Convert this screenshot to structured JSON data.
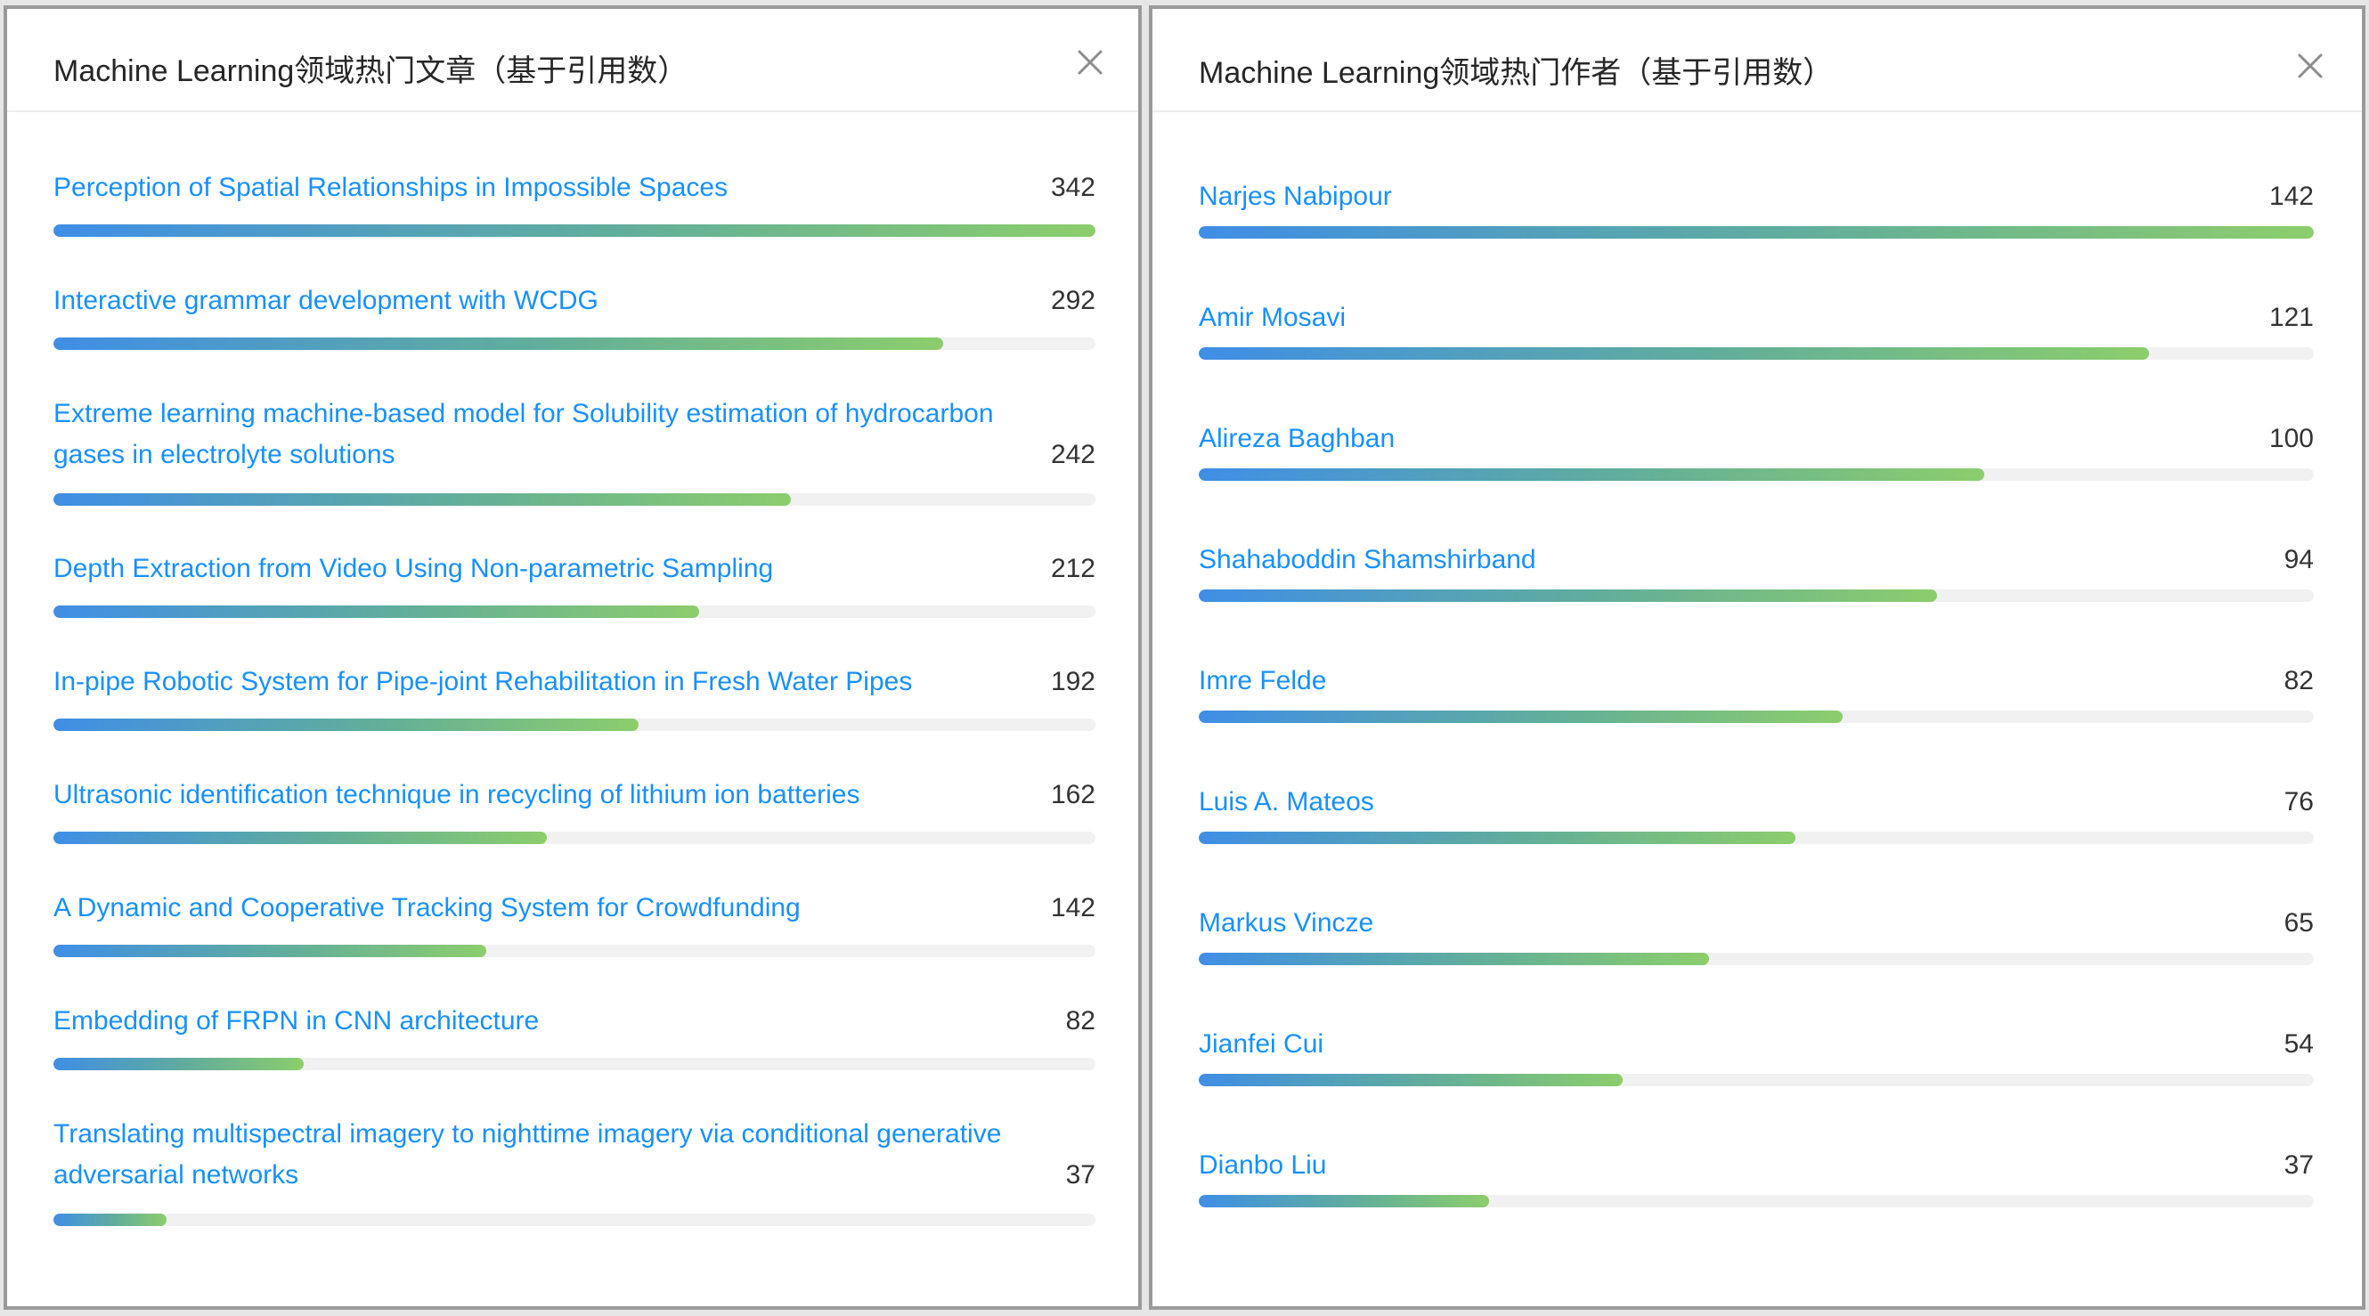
{
  "articles_panel": {
    "title": "Machine Learning领域热门文章（基于引用数）",
    "close_icon": "close-icon",
    "max": 342,
    "items": [
      {
        "label": "Perception of Spatial Relationships in Impossible Spaces",
        "count": "342",
        "value": 342
      },
      {
        "label": "Interactive grammar development with WCDG",
        "count": "292",
        "value": 292
      },
      {
        "label": "Extreme learning machine-based model for Solubility estimation of hydrocarbon gases in electrolyte solutions",
        "count": "242",
        "value": 242
      },
      {
        "label": "Depth Extraction from Video Using Non-parametric Sampling",
        "count": "212",
        "value": 212
      },
      {
        "label": "In-pipe Robotic System for Pipe-joint Rehabilitation in Fresh Water Pipes",
        "count": "192",
        "value": 192
      },
      {
        "label": "Ultrasonic identification technique in recycling of lithium ion batteries",
        "count": "162",
        "value": 162
      },
      {
        "label": "A Dynamic and Cooperative Tracking System for Crowdfunding",
        "count": "142",
        "value": 142
      },
      {
        "label": "Embedding of FRPN in CNN architecture",
        "count": "82",
        "value": 82
      },
      {
        "label": "Translating multispectral imagery to nighttime imagery via conditional generative adversarial networks",
        "count": "37",
        "value": 37
      }
    ]
  },
  "authors_panel": {
    "title": "Machine Learning领域热门作者（基于引用数）",
    "close_icon": "close-icon",
    "max": 142,
    "items": [
      {
        "label": "Narjes Nabipour",
        "count": "142",
        "value": 142
      },
      {
        "label": "Amir Mosavi",
        "count": "121",
        "value": 121
      },
      {
        "label": "Alireza Baghban",
        "count": "100",
        "value": 100
      },
      {
        "label": "Shahaboddin Shamshirband",
        "count": "94",
        "value": 94
      },
      {
        "label": "Imre Felde",
        "count": "82",
        "value": 82
      },
      {
        "label": "Luis A. Mateos",
        "count": "76",
        "value": 76
      },
      {
        "label": "Markus Vincze",
        "count": "65",
        "value": 65
      },
      {
        "label": "Jianfei Cui",
        "count": "54",
        "value": 54
      },
      {
        "label": "Dianbo Liu",
        "count": "37",
        "value": 37
      }
    ]
  },
  "colors": {
    "link": "#1890ff",
    "bar_start": "#3f8ee6",
    "bar_end": "#8ccd6c",
    "track": "#f1f1f1"
  }
}
